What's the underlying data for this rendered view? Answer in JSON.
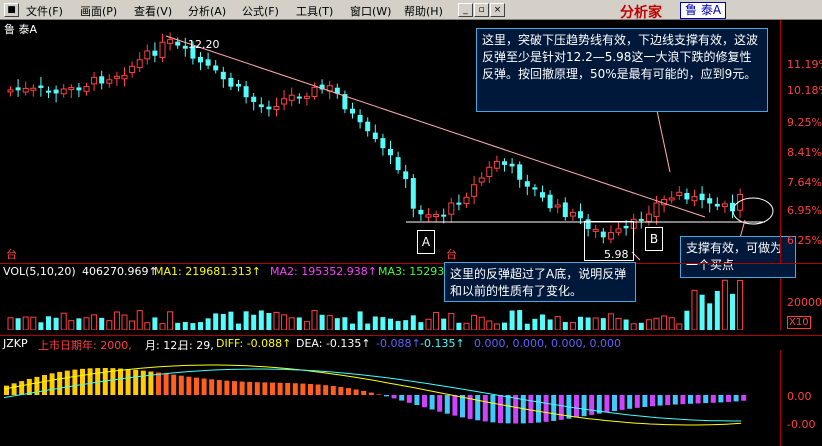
{
  "menu": {
    "items": [
      "文件(F)",
      "画面(P)",
      "查看(V)",
      "分析(A)",
      "公式(F)",
      "工具(T)",
      "窗口(W)",
      "帮助(H)"
    ],
    "brand": "分析家",
    "stock_tag": "鲁 泰A"
  },
  "main_chart": {
    "title": "鲁 泰A",
    "peak_label": "12.20",
    "low_label": "5.98",
    "price_axis": [
      "11.19%",
      "10.18%",
      "9.25%",
      "8.41%",
      "7.64%",
      "6.95%",
      "6.25%"
    ],
    "box_a": "A",
    "box_b": "B",
    "red_marks": [
      "台",
      "台"
    ],
    "colors": {
      "up": "#ff4040",
      "down": "#54fcfc",
      "trend": "#ffb0b0",
      "support": "#ffffff",
      "border": "#b00000"
    }
  },
  "volume_bar": {
    "label": "VOL(5,10,20)",
    "vol": "406270.969↑",
    "ma1": "MA1: 219681.313↑",
    "ma2": "MA2: 195352.938↑",
    "ma3": "MA3: 15293",
    "axis": [
      "20000",
      "X10"
    ]
  },
  "jzkp_bar": {
    "name": "JZKP",
    "date": "上市日期年: 2000,",
    "month": "月: 12,",
    "day": "日: 29,",
    "diff": "DIFF: -0.088↑",
    "dea": "DEA: -0.135↑",
    "v1": "-0.088↑",
    "v2": "-0.135↑",
    "v3": "0.000, 0.000, 0.000, 0.000",
    "axis": [
      "0.00",
      "-0.00"
    ]
  },
  "annotations": {
    "top": "这里，突破下压趋势线有效，下边线支撑有效，这波反弹至少是针对12.2—5.98这一大浪下跌的修复性反弹。按回撤原理，50%是最有可能的，应到9元。",
    "support": "支撑有效，可做为一个买点",
    "rebound": "这里的反弹超过了A底，说明反弹和以前的性质有了变化。"
  },
  "chart_data": {
    "type": "candlestick",
    "title": "鲁 泰A",
    "annotated_points": [
      {
        "label": "12.20",
        "y": 12.2
      },
      {
        "label": "5.98",
        "y": 5.98
      }
    ],
    "price_axis_ticks": [
      "11.19%",
      "10.18%",
      "9.25%",
      "8.41%",
      "7.64%",
      "6.95%",
      "6.25%"
    ]
  }
}
